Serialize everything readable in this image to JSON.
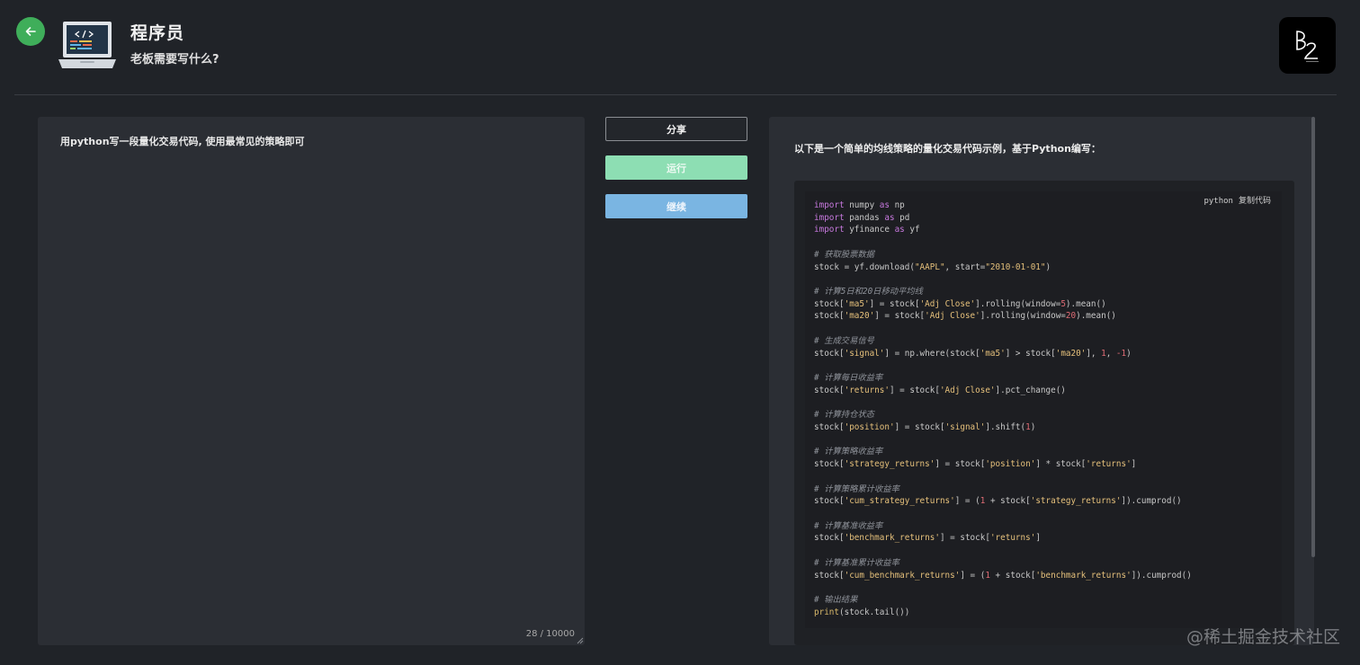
{
  "header": {
    "title": "程序员",
    "subtitle": "老板需要写什么?"
  },
  "input": {
    "prompt": "用python写一段量化交易代码, 使用最常见的策略即可",
    "char_count": "28 / 10000"
  },
  "buttons": {
    "share": "分享",
    "run": "运行",
    "continue": "继续"
  },
  "output": {
    "intro": "以下是一个简单的均线策略的量化交易代码示例，基于Python编写：",
    "code_language": "python",
    "copy_label": "复制代码",
    "code_lines": [
      "import numpy as np",
      "import pandas as pd",
      "import yfinance as yf",
      "",
      "# 获取股票数据",
      "stock = yf.download(\"AAPL\", start=\"2010-01-01\")",
      "",
      "# 计算5日和20日移动平均线",
      "stock['ma5'] = stock['Adj Close'].rolling(window=5).mean()",
      "stock['ma20'] = stock['Adj Close'].rolling(window=20).mean()",
      "",
      "# 生成交易信号",
      "stock['signal'] = np.where(stock['ma5'] > stock['ma20'], 1, -1)",
      "",
      "# 计算每日收益率",
      "stock['returns'] = stock['Adj Close'].pct_change()",
      "",
      "# 计算持仓状态",
      "stock['position'] = stock['signal'].shift(1)",
      "",
      "# 计算策略收益率",
      "stock['strategy_returns'] = stock['position'] * stock['returns']",
      "",
      "# 计算策略累计收益率",
      "stock['cum_strategy_returns'] = (1 + stock['strategy_returns']).cumprod()",
      "",
      "# 计算基准收益率",
      "stock['benchmark_returns'] = stock['returns']",
      "",
      "# 计算基准累计收益率",
      "stock['cum_benchmark_returns'] = (1 + stock['benchmark_returns']).cumprod()",
      "",
      "# 输出结果",
      "print(stock.tail())"
    ]
  },
  "watermark": "@稀土掘金技术社区",
  "colors": {
    "background": "#202328",
    "panel": "#2b2e34",
    "back_button": "#3fae5a",
    "run_button": "#8ddeb3",
    "continue_button": "#7ab5e2"
  },
  "icons": [
    "arrow-left-icon",
    "laptop-code-icon",
    "brand-logo"
  ]
}
